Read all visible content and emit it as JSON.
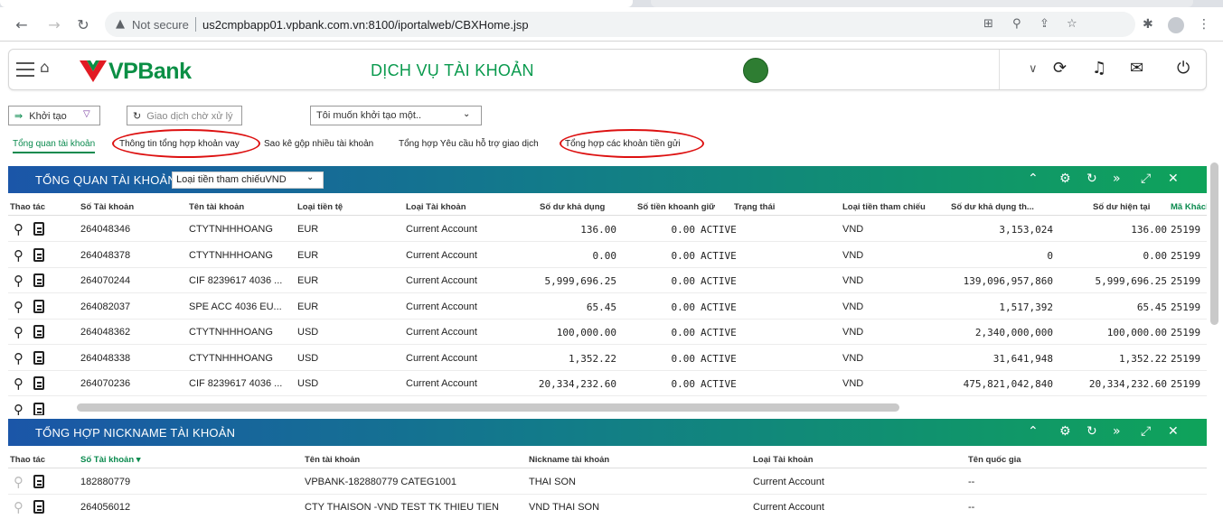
{
  "browser": {
    "not_secure": "Not secure",
    "url": "us2cmpbapp01.vpbank.com.vn:8100/iportalweb/CBXHome.jsp"
  },
  "header": {
    "logo_text": "VPBank",
    "title": "DỊCH VỤ TÀI KHOẢN",
    "brand_color": "#0b8f45"
  },
  "toolbar": {
    "create_label": "Khởi tạo",
    "pending_placeholder": "Giao dịch chờ xử lý",
    "want_select": "Tôi muốn khởi tạo một.."
  },
  "tabs": [
    "Tổng quan tài khoản",
    "Thông tin tổng hợp khoản vay",
    "Sao kê gộp nhiều tài khoản",
    "Tổng hợp Yêu cầu hỗ trợ giao dịch",
    "Tổng hợp các khoản tiền gửi"
  ],
  "overview": {
    "title": "TỔNG QUAN TÀI KHOẢN",
    "ref_currency": "Loại tiền tham chiếuVND",
    "columns": [
      "Thao tác",
      "Số Tài khoản",
      "Tên tài khoản",
      "Loại tiền tệ",
      "Loại Tài khoản",
      "Số dư khả dụng",
      "Số tiền khoanh giữ",
      "Trạng thái",
      "Loại tiền tham chiếu",
      "Số dư khả dụng th...",
      "Số dư hiện tại",
      "Mã Khách"
    ],
    "rows": [
      {
        "acc": "264048346",
        "name": "CTYTNHHHOANG",
        "ccy": "EUR",
        "type": "Current Account",
        "avail": "136.00",
        "hold": "0.00",
        "status": "ACTIVE",
        "ref": "VND",
        "avail_ref": "3,153,024",
        "current": "136.00",
        "cust": "25199"
      },
      {
        "acc": "264048378",
        "name": "CTYTNHHHOANG",
        "ccy": "EUR",
        "type": "Current Account",
        "avail": "0.00",
        "hold": "0.00",
        "status": "ACTIVE",
        "ref": "VND",
        "avail_ref": "0",
        "current": "0.00",
        "cust": "25199"
      },
      {
        "acc": "264070244",
        "name": "CIF 8239617 4036 ...",
        "ccy": "EUR",
        "type": "Current Account",
        "avail": "5,999,696.25",
        "hold": "0.00",
        "status": "ACTIVE",
        "ref": "VND",
        "avail_ref": "139,096,957,860",
        "current": "5,999,696.25",
        "cust": "25199"
      },
      {
        "acc": "264082037",
        "name": "SPE ACC 4036 EU...",
        "ccy": "EUR",
        "type": "Current Account",
        "avail": "65.45",
        "hold": "0.00",
        "status": "ACTIVE",
        "ref": "VND",
        "avail_ref": "1,517,392",
        "current": "65.45",
        "cust": "25199"
      },
      {
        "acc": "264048362",
        "name": "CTYTNHHHOANG",
        "ccy": "USD",
        "type": "Current Account",
        "avail": "100,000.00",
        "hold": "0.00",
        "status": "ACTIVE",
        "ref": "VND",
        "avail_ref": "2,340,000,000",
        "current": "100,000.00",
        "cust": "25199"
      },
      {
        "acc": "264048338",
        "name": "CTYTNHHHOANG",
        "ccy": "USD",
        "type": "Current Account",
        "avail": "1,352.22",
        "hold": "0.00",
        "status": "ACTIVE",
        "ref": "VND",
        "avail_ref": "31,641,948",
        "current": "1,352.22",
        "cust": "25199"
      },
      {
        "acc": "264070236",
        "name": "CIF 8239617 4036 ...",
        "ccy": "USD",
        "type": "Current Account",
        "avail": "20,334,232.60",
        "hold": "0.00",
        "status": "ACTIVE",
        "ref": "VND",
        "avail_ref": "475,821,042,840",
        "current": "20,334,232.60",
        "cust": "25199"
      }
    ]
  },
  "nickname": {
    "title": "TỔNG HỢP NICKNAME TÀI KHOẢN",
    "columns": [
      "Thao tác",
      "Số Tài khoản ▾",
      "Tên tài khoản",
      "Nickname tài khoản",
      "Loại Tài khoản",
      "Tên quốc gia"
    ],
    "rows": [
      {
        "acc": "182880779",
        "name": "VPBANK-182880779 CATEG1001",
        "nick": "THAI SON",
        "type": "Current Account",
        "country": "--"
      },
      {
        "acc": "264056012",
        "name": "CTY THAISON -VND TEST TK THIEU TIEN",
        "nick": "VND THAI SON",
        "type": "Current Account",
        "country": "--"
      }
    ]
  }
}
